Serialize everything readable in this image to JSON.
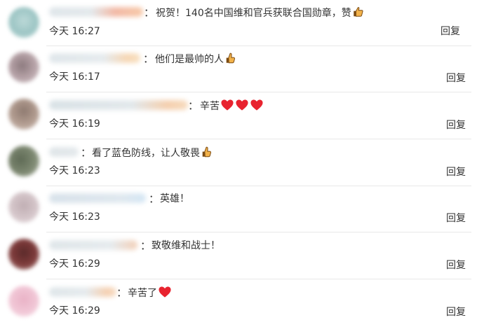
{
  "comments": [
    {
      "text": "祝贺！140名中国维和官兵获联合国勋章，赞",
      "emojis": [
        "thumbs-up"
      ],
      "time": "今天 16:27",
      "reply": "回复"
    },
    {
      "text": "他们是最帅的人",
      "emojis": [
        "thumbs-up"
      ],
      "time": "今天 16:17",
      "reply": "回复"
    },
    {
      "text": "辛苦",
      "emojis": [
        "heart",
        "heart",
        "heart"
      ],
      "time": "今天 16:19",
      "reply": "回复"
    },
    {
      "text": "看了蓝色防线，让人敬畏",
      "emojis": [
        "thumbs-up"
      ],
      "time": "今天 16:23",
      "reply": "回复"
    },
    {
      "text": "英雄！",
      "emojis": [],
      "time": "今天 16:23",
      "reply": "回复"
    },
    {
      "text": "致敬维和战士！",
      "emojis": [],
      "time": "今天 16:29",
      "reply": "回复"
    },
    {
      "text": "辛苦了",
      "emojis": [
        "heart"
      ],
      "time": "今天 16:29",
      "reply": "回复"
    }
  ],
  "colors": {
    "text": "#333333",
    "divider": "#e8e8e8",
    "background": "#ffffff",
    "heart": "#e8232f",
    "thumb": "#f2b24a"
  }
}
